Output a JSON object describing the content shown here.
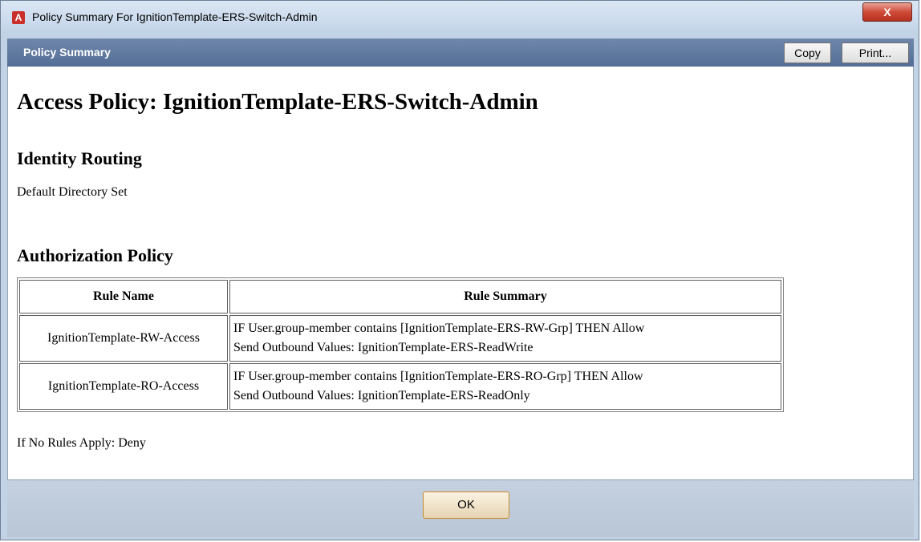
{
  "window": {
    "title": "Policy Summary For IgnitionTemplate-ERS-Switch-Admin",
    "app_icon": "A",
    "close_label": "X"
  },
  "panel": {
    "title": "Policy Summary",
    "copy_label": "Copy",
    "print_label": "Print..."
  },
  "content": {
    "page_title": "Access Policy: IgnitionTemplate-ERS-Switch-Admin",
    "identity_heading": "Identity Routing",
    "identity_value": "Default Directory Set",
    "auth_heading": "Authorization Policy",
    "table": {
      "headers": [
        "Rule Name",
        "Rule Summary"
      ],
      "rows": [
        {
          "name": "IgnitionTemplate-RW-Access",
          "summary1": "IF User.group-member contains [IgnitionTemplate-ERS-RW-Grp] THEN Allow",
          "summary2": "Send Outbound Values: IgnitionTemplate-ERS-ReadWrite"
        },
        {
          "name": "IgnitionTemplate-RO-Access",
          "summary1": "IF User.group-member contains [IgnitionTemplate-ERS-RO-Grp] THEN Allow",
          "summary2": "Send Outbound Values: IgnitionTemplate-ERS-ReadOnly"
        }
      ]
    },
    "default_rule": "If No Rules Apply: Deny"
  },
  "footer": {
    "ok_label": "OK"
  }
}
